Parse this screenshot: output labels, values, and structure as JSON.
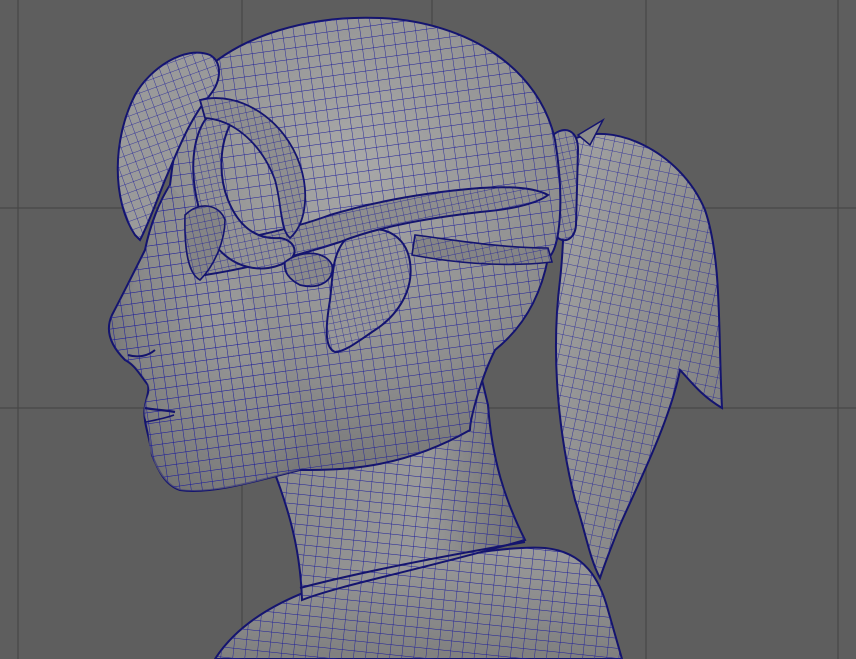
{
  "viewport": {
    "background_color": "#5e5e5e",
    "grid_line_color": "#474747",
    "wire_color": "#1a1a8c",
    "surface_color": "#8c8c8c",
    "surface_highlight": "#a7a7a7",
    "surface_shadow": "#6f6f6f"
  },
  "model": {
    "subject": "female-head-wireframe-mesh",
    "view": "side-profile",
    "parts": [
      "head",
      "neck",
      "shoulders",
      "ear",
      "ponytail",
      "hair-bun",
      "headband-goggles"
    ]
  }
}
